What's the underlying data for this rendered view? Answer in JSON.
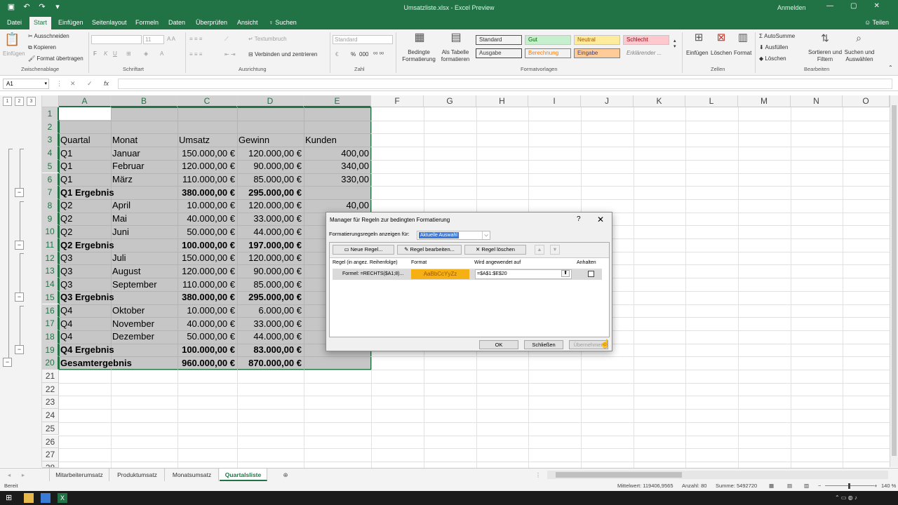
{
  "window": {
    "title": "Umsatzliste.xlsx - Excel Preview",
    "signin": "Anmelden"
  },
  "ribbon_tabs": [
    "Datei",
    "Start",
    "Einfügen",
    "Seitenlayout",
    "Formeln",
    "Daten",
    "Überprüfen",
    "Ansicht",
    "Suchen"
  ],
  "share_label": "Teilen",
  "ribbon": {
    "clipboard": {
      "paste": "Einfügen",
      "cut": "Ausschneiden",
      "copy": "Kopieren",
      "format_painter": "Format übertragen",
      "label": "Zwischenablage"
    },
    "font": {
      "size": "11",
      "bold": "F",
      "italic": "K",
      "underline": "U",
      "label": "Schriftart"
    },
    "alignment": {
      "wrap": "Textumbruch",
      "merge": "Verbinden und zentrieren",
      "label": "Ausrichtung"
    },
    "number": {
      "format": "Standard",
      "percent": "%",
      "thousands": "000",
      "label": "Zahl"
    },
    "styles": {
      "conditional": "Bedingte Formatierung",
      "as_table": "Als Tabelle formatieren",
      "cell_styles": [
        {
          "name": "Standard",
          "bg": "#ffffff",
          "fg": "#000000"
        },
        {
          "name": "Gut",
          "bg": "#c6efce",
          "fg": "#006100"
        },
        {
          "name": "Neutral",
          "bg": "#ffeb9c",
          "fg": "#9c5700"
        },
        {
          "name": "Schlecht",
          "bg": "#ffc7ce",
          "fg": "#9c0006"
        },
        {
          "name": "Ausgabe",
          "bg": "#f2f2f2",
          "fg": "#3f3f3f"
        },
        {
          "name": "Berechnung",
          "bg": "#f2f2f2",
          "fg": "#fa7d00"
        },
        {
          "name": "Eingabe",
          "bg": "#ffcc99",
          "fg": "#3f3f76"
        },
        {
          "name": "Erklärender ...",
          "bg": "#ffffff",
          "fg": "#7f7f7f"
        }
      ],
      "label": "Formatvorlagen"
    },
    "cells": {
      "insert": "Einfügen",
      "delete": "Löschen",
      "format": "Format",
      "label": "Zellen"
    },
    "editing": {
      "autosum": "AutoSumme",
      "fill": "Ausfüllen",
      "clear": "Löschen",
      "sort": "Sortieren und Filtern",
      "find": "Suchen und Auswählen",
      "label": "Bearbeiten"
    }
  },
  "formula_bar": {
    "name_box": "A1",
    "fx": "fx",
    "cancel": "✕",
    "enter": "✓",
    "content": ""
  },
  "outline_levels": [
    "1",
    "2",
    "3"
  ],
  "columns": [
    "A",
    "B",
    "C",
    "D",
    "E",
    "F",
    "G",
    "H",
    "I",
    "J",
    "K",
    "L",
    "M",
    "N",
    "O"
  ],
  "rows": [
    "1",
    "2",
    "3",
    "4",
    "5",
    "6",
    "7",
    "8",
    "9",
    "10",
    "11",
    "12",
    "13",
    "14",
    "15",
    "16",
    "17",
    "18",
    "19",
    "20",
    "21",
    "22",
    "23",
    "24",
    "25",
    "26",
    "27",
    "28"
  ],
  "table": {
    "headers": [
      "Quartal",
      "Monat",
      "Umsatz",
      "Gewinn",
      "Kunden"
    ],
    "rows": [
      {
        "a": "Q1",
        "b": "Januar",
        "c": "150.000,00 €",
        "d": "120.000,00 €",
        "e": "400,00",
        "bold": false
      },
      {
        "a": "Q1",
        "b": "Februar",
        "c": "120.000,00 €",
        "d": "90.000,00 €",
        "e": "340,00",
        "bold": false
      },
      {
        "a": "Q1",
        "b": "März",
        "c": "110.000,00 €",
        "d": "85.000,00 €",
        "e": "330,00",
        "bold": false
      },
      {
        "a": "Q1 Ergebnis",
        "b": "",
        "c": "380.000,00 €",
        "d": "295.000,00 €",
        "e": "",
        "bold": true
      },
      {
        "a": "Q2",
        "b": "April",
        "c": "10.000,00 €",
        "d": "120.000,00 €",
        "e": "40,00",
        "bold": false
      },
      {
        "a": "Q2",
        "b": "Mai",
        "c": "40.000,00 €",
        "d": "33.000,00 €",
        "e": "",
        "bold": false
      },
      {
        "a": "Q2",
        "b": "Juni",
        "c": "50.000,00 €",
        "d": "44.000,00 €",
        "e": "",
        "bold": false
      },
      {
        "a": "Q2 Ergebnis",
        "b": "",
        "c": "100.000,00 €",
        "d": "197.000,00 €",
        "e": "",
        "bold": true
      },
      {
        "a": "Q3",
        "b": "Juli",
        "c": "150.000,00 €",
        "d": "120.000,00 €",
        "e": "",
        "bold": false
      },
      {
        "a": "Q3",
        "b": "August",
        "c": "120.000,00 €",
        "d": "90.000,00 €",
        "e": "",
        "bold": false
      },
      {
        "a": "Q3",
        "b": "September",
        "c": "110.000,00 €",
        "d": "85.000,00 €",
        "e": "",
        "bold": false
      },
      {
        "a": "Q3 Ergebnis",
        "b": "",
        "c": "380.000,00 €",
        "d": "295.000,00 €",
        "e": "",
        "bold": true
      },
      {
        "a": "Q4",
        "b": "Oktober",
        "c": "10.000,00 €",
        "d": "6.000,00 €",
        "e": "",
        "bold": false
      },
      {
        "a": "Q4",
        "b": "November",
        "c": "40.000,00 €",
        "d": "33.000,00 €",
        "e": "",
        "bold": false
      },
      {
        "a": "Q4",
        "b": "Dezember",
        "c": "50.000,00 €",
        "d": "44.000,00 €",
        "e": "",
        "bold": false
      },
      {
        "a": "Q4 Ergebnis",
        "b": "",
        "c": "100.000,00 €",
        "d": "83.000,00 €",
        "e": "",
        "bold": true
      },
      {
        "a": "Gesamtergebnis",
        "b": "",
        "c": "960.000,00 €",
        "d": "870.000,00 €",
        "e": "",
        "bold": true
      }
    ]
  },
  "sheets": [
    "Mitarbeiterumsatz",
    "Produktumsatz",
    "Monatsumsatz",
    "Quartalsliste"
  ],
  "active_sheet": "Quartalsliste",
  "status": {
    "ready": "Bereit",
    "average": "Mittelwert: 119406,9565",
    "count": "Anzahl: 80",
    "sum": "Summe: 5492720",
    "zoom": "140 %"
  },
  "dialog": {
    "title": "Manager für Regeln zur bedingten Formatierung",
    "help": "?",
    "close": "✕",
    "show_rules_label": "Formatierungsregeln anzeigen für:",
    "show_rules_value": "Aktuelle Auswahl",
    "new_rule": "Neue Regel...",
    "edit_rule": "Regel bearbeiten...",
    "delete_rule": "Regel löschen",
    "move_up": "▲",
    "move_down": "▼",
    "col_rule": "Regel (in angez. Reihenfolge)",
    "col_format": "Format",
    "col_applies": "Wird angewendet auf",
    "col_stop": "Anhalten",
    "rule_text": "Formel: =RECHTS($A1;8)...",
    "rule_preview": "AaBbCcYyZz",
    "rule_range": "=$A$1:$E$20",
    "ok": "OK",
    "close_btn": "Schließen",
    "apply": "Übernehmen"
  }
}
